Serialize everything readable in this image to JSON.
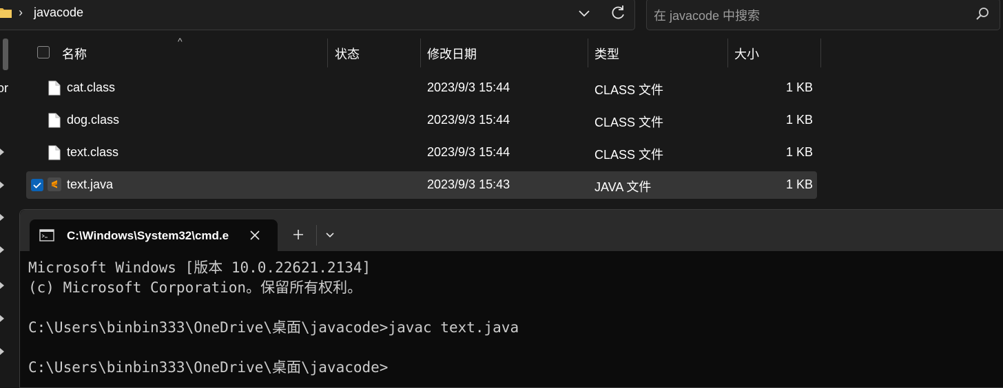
{
  "explorer": {
    "breadcrumb": {
      "chevron": "›",
      "current": "javacode"
    },
    "search": {
      "placeholder": "在 javacode 中搜索"
    },
    "nav_pane": {
      "partial_text": "or"
    },
    "columns": {
      "name": "名称",
      "status": "状态",
      "modified": "修改日期",
      "type": "类型",
      "size": "大小"
    },
    "files": [
      {
        "name": "cat.class",
        "modified": "2023/9/3 15:44",
        "type": "CLASS 文件",
        "size": "1 KB",
        "icon": "file-icon"
      },
      {
        "name": "dog.class",
        "modified": "2023/9/3 15:44",
        "type": "CLASS 文件",
        "size": "1 KB",
        "icon": "file-icon"
      },
      {
        "name": "text.class",
        "modified": "2023/9/3 15:44",
        "type": "CLASS 文件",
        "size": "1 KB",
        "icon": "file-icon"
      },
      {
        "name": "text.java",
        "modified": "2023/9/3 15:43",
        "type": "JAVA 文件",
        "size": "1 KB",
        "icon": "sublime-text-icon",
        "selected": true
      }
    ]
  },
  "terminal": {
    "tab_title": "C:\\Windows\\System32\\cmd.e",
    "lines": [
      "Microsoft Windows [版本 10.0.22621.2134]",
      "(c) Microsoft Corporation。保留所有权利。",
      "",
      "C:\\Users\\binbin333\\OneDrive\\桌面\\javacode>javac text.java",
      "",
      "C:\\Users\\binbin333\\OneDrive\\桌面\\javacode>"
    ]
  },
  "colors": {
    "background": "#191919",
    "selection": "#363636",
    "accent": "#0a63b8",
    "terminal_bg": "#0c0c0c"
  }
}
